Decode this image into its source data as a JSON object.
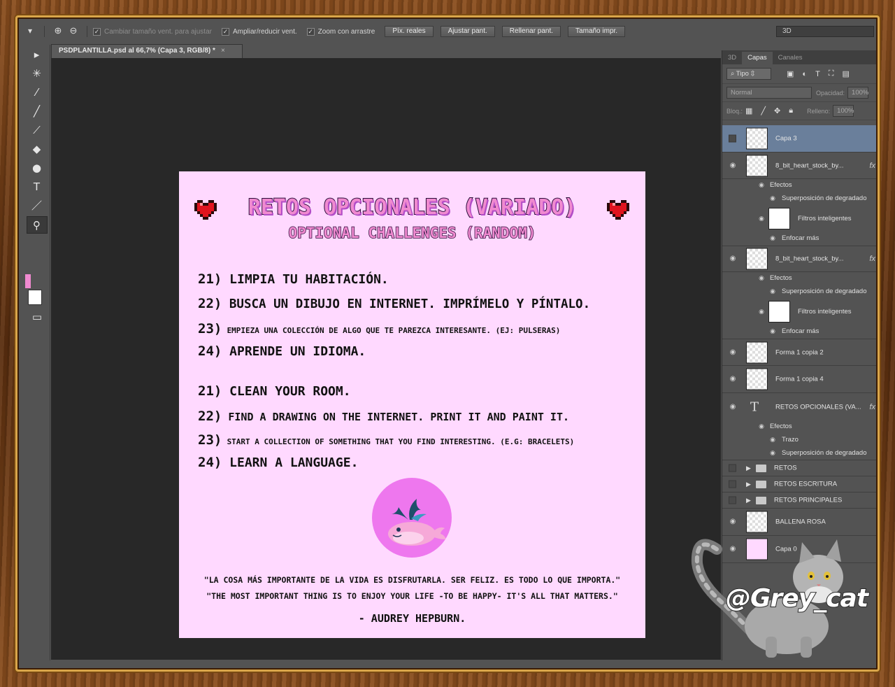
{
  "optionsbar": {
    "chk_resize_window": "Cambiar tamaño vent. para ajustar",
    "chk_zoom_all": "Ampliar/reducir vent.",
    "chk_scrubby": "Zoom con arrastre",
    "btn_actual_pixels": "Píx. reales",
    "btn_fit_screen": "Ajustar pant.",
    "btn_fill_screen": "Rellenar pant.",
    "btn_print_size": "Tamaño impr.",
    "workspace": "3D"
  },
  "document_tab": {
    "title": "PSDPLANTILLA.psd al 66,7% (Capa 3, RGB/8) *",
    "close": "×"
  },
  "document": {
    "title": "RETOS OPCIONALES (VARIADO)",
    "subtitle": "OPTIONAL CHALLENGES (RANDOM)",
    "es": [
      {
        "num": "21)",
        "text": "LIMPIA TU HABITACIÓN."
      },
      {
        "num": "22)",
        "text": "BUSCA UN DIBUJO EN INTERNET. IMPRÍMELO Y PÍNTALO."
      },
      {
        "num": "23)",
        "text": "EMPIEZA UNA COLECCIÓN DE ALGO QUE TE PAREZCA INTERESANTE. (EJ: PULSERAS)"
      },
      {
        "num": "24)",
        "text": "APRENDE UN IDIOMA."
      }
    ],
    "en": [
      {
        "num": "21)",
        "text": "CLEAN YOUR ROOM."
      },
      {
        "num": "22)",
        "text": "FIND A DRAWING ON THE INTERNET. PRINT IT AND PAINT IT."
      },
      {
        "num": "23)",
        "text": "START A COLLECTION OF SOMETHING THAT YOU FIND INTERESTING. (E.G: BRACELETS)"
      },
      {
        "num": "24)",
        "text": "LEARN A LANGUAGE."
      }
    ],
    "quote_es": "\"LA COSA MÁS IMPORTANTE DE LA VIDA ES DISFRUTARLA. SER FELIZ. ES TODO LO QUE IMPORTA.\"",
    "quote_en": "\"THE MOST IMPORTANT THING IS TO ENJOY YOUR LIFE -TO BE HAPPY- IT'S ALL THAT MATTERS.\"",
    "author": "- AUDREY HEPBURN."
  },
  "panel": {
    "tabs": [
      "3D",
      "Capas",
      "Canales"
    ],
    "filter_type": "Tipo",
    "blend_mode": "Normal",
    "opacity_label": "Opacidad:",
    "opacity_value": "100%",
    "lock_label": "Bloq.:",
    "fill_label": "Relleno:",
    "fill_value": "100%"
  },
  "layers": {
    "capa3": "Capa 3",
    "heart1": "8_bit_heart_stock_by...",
    "efectos": "Efectos",
    "grad_overlay": "Superposición de degradado",
    "smart_filters": "Filtros inteligentes",
    "sharpen_more": "Enfocar más",
    "heart2": "8_bit_heart_stock_by...",
    "forma_copia2": "Forma 1 copia 2",
    "forma_copia4": "Forma 1 copia 4",
    "retos_text": "RETOS OPCIONALES (VA...",
    "trazo": "Trazo",
    "folder_retos": "RETOS",
    "folder_escritura": "RETOS ESCRITURA",
    "folder_principales": "RETOS PRINCIPALES",
    "ballena": "BALLENA ROSA",
    "capa0": "Capa 0",
    "fx": "fx"
  },
  "watermark": "@Grey_cat",
  "colors": {
    "foreground": "#f08ad0",
    "background": "#ffffff",
    "doc_bg": "#ffd9ff",
    "title_fill": "#f08ad0",
    "selected_layer": "#6a7f9b"
  }
}
